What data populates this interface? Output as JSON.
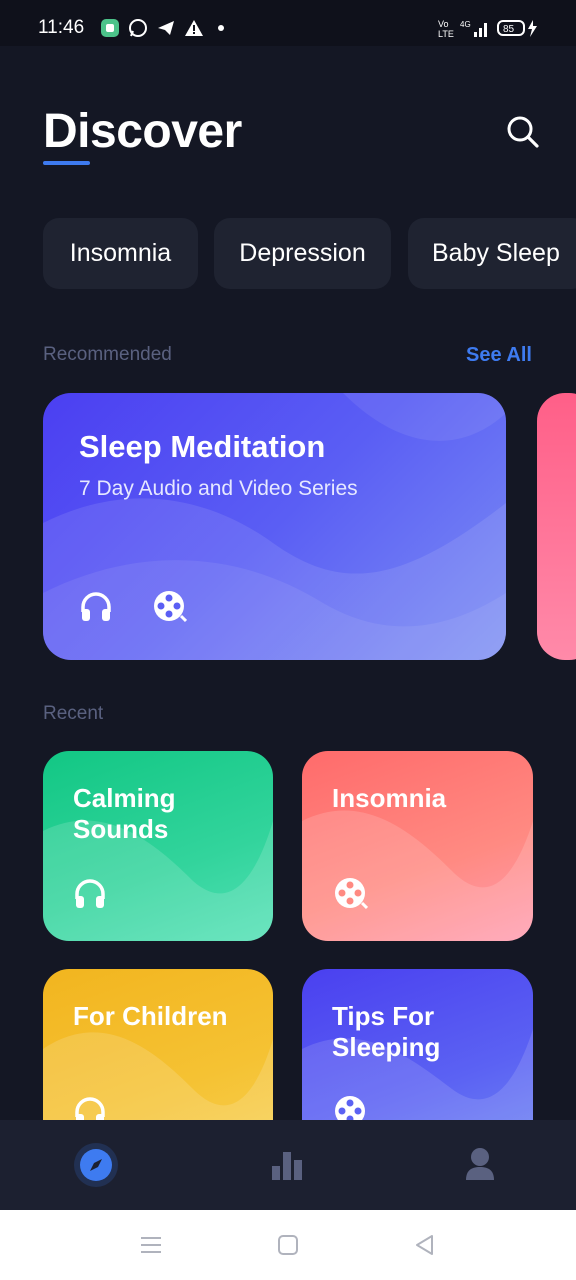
{
  "status_bar": {
    "time": "11:46",
    "battery": "85"
  },
  "header": {
    "title": "Discover"
  },
  "chips": [
    {
      "label": "Insomnia"
    },
    {
      "label": "Depression"
    },
    {
      "label": "Baby Sleep"
    }
  ],
  "recommended": {
    "label": "Recommended",
    "see_all": "See All",
    "featured": {
      "title": "Sleep Meditation",
      "subtitle": "7 Day Audio and Video Series"
    }
  },
  "recent": {
    "label": "Recent",
    "cards": [
      {
        "title": "Calming Sounds",
        "icon": "headphones-icon"
      },
      {
        "title": "Insomnia",
        "icon": "film-reel-icon"
      },
      {
        "title": "For Children",
        "icon": "headphones-icon"
      },
      {
        "title": "Tips For Sleeping",
        "icon": "film-reel-icon"
      }
    ]
  },
  "colors": {
    "accent": "#3e7bf0",
    "background": "#141724",
    "chip": "#1f2331"
  }
}
